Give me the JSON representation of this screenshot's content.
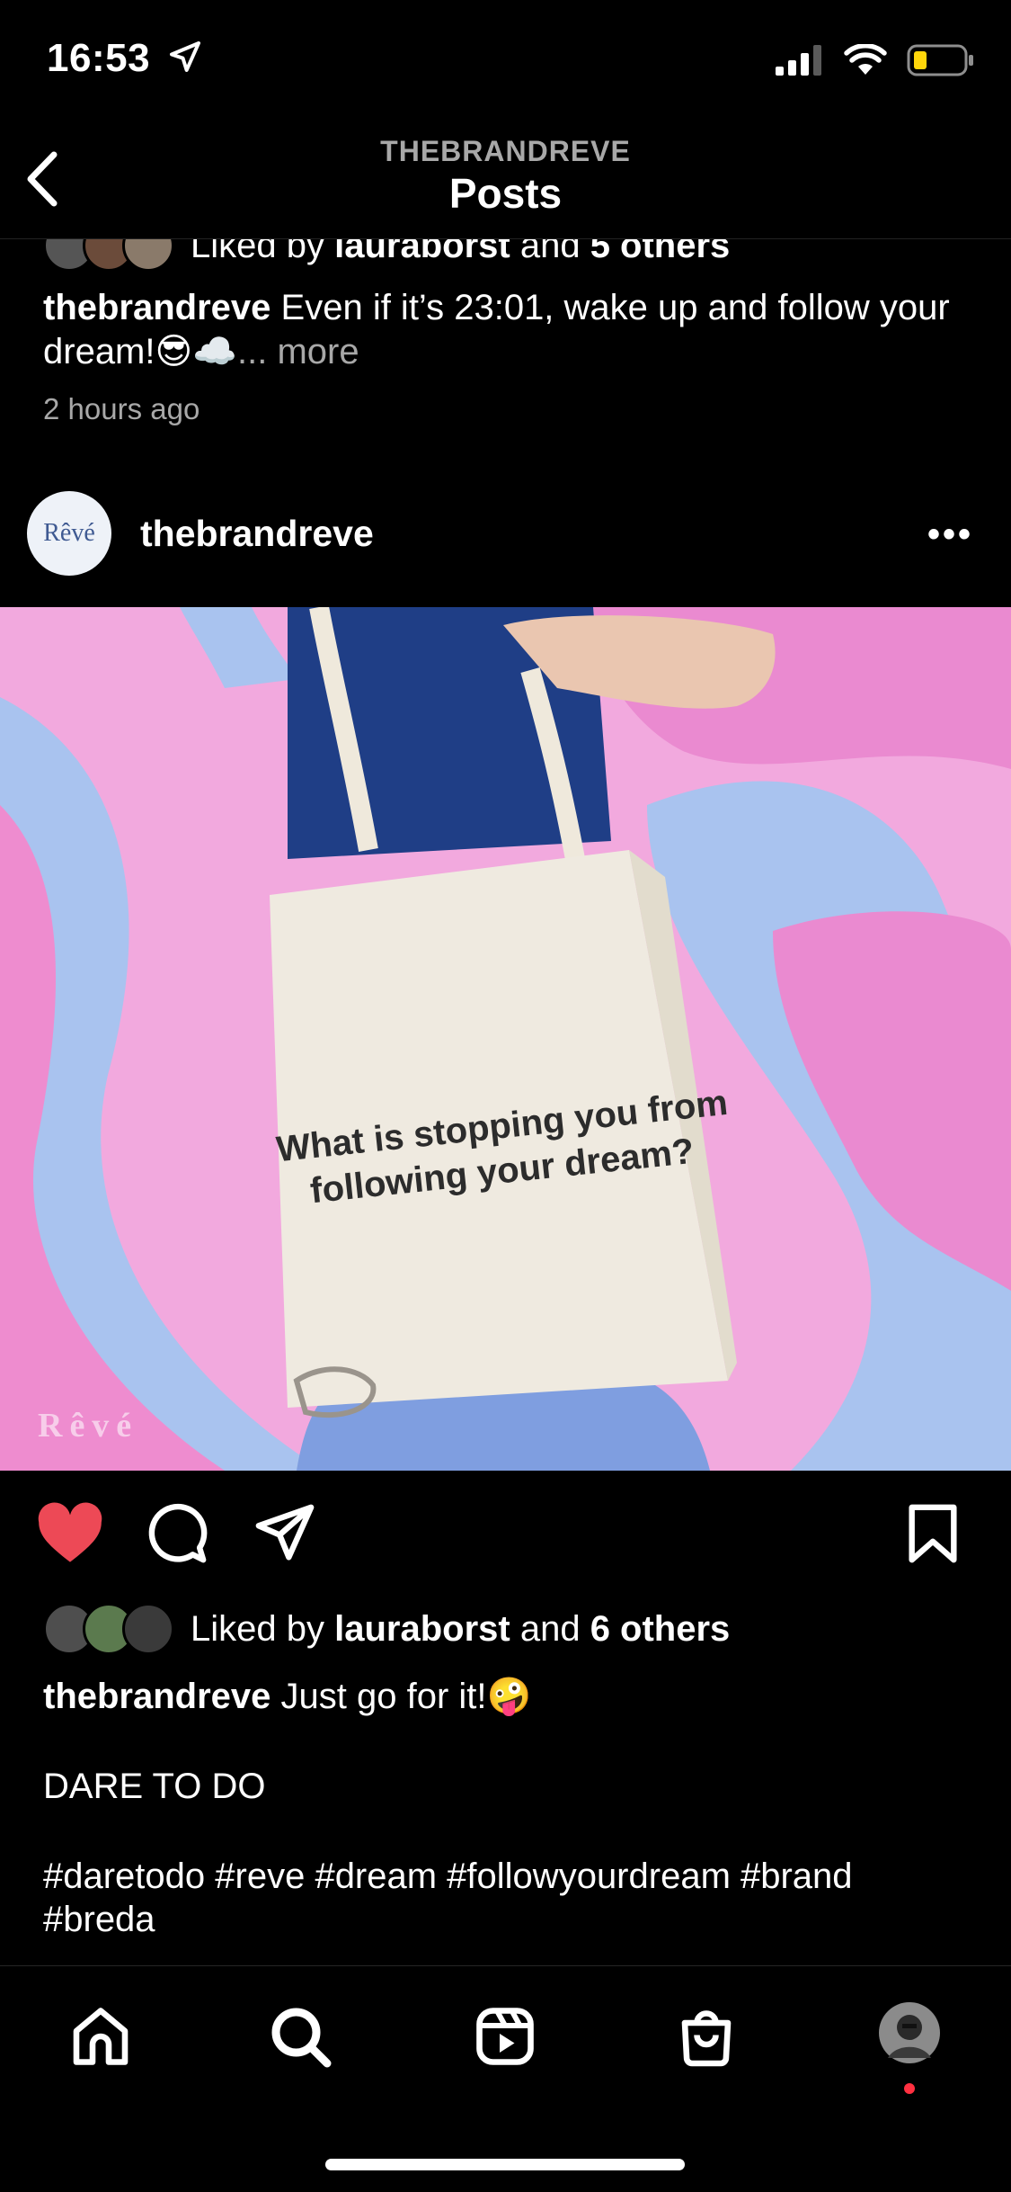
{
  "status_bar": {
    "time": "16:53"
  },
  "header": {
    "account": "THEBRANDREVE",
    "title": "Posts"
  },
  "previous_post": {
    "liked_prefix": "Liked by ",
    "liked_user": "lauraborst",
    "liked_mid": " and ",
    "liked_others": "5 others",
    "username": "thebrandreve",
    "caption": " Even if it’s 23:01, wake up and follow your dream!😎☁️",
    "more": "... more",
    "time": "2 hours ago"
  },
  "post": {
    "avatar_text": "Rêvé",
    "username": "thebrandreve",
    "image": {
      "bag_line1": "What is stopping you from",
      "bag_line2": "following your dream?",
      "watermark": "Rêvé"
    },
    "liked_prefix": "Liked by ",
    "liked_user": "lauraborst",
    "liked_mid": " and ",
    "liked_others": "6 others",
    "caption_user": "thebrandreve",
    "caption_text": " Just go for it!🤪",
    "caption_line2": "DARE TO DO",
    "hashtags": "#daretodo #reve #dream #followyourdream #brand #breda"
  },
  "colors": {
    "like": "#ed4956",
    "muted": "#a8a8a8"
  },
  "icons": [
    "location-arrow-icon",
    "signal-icon",
    "wifi-icon",
    "battery-icon",
    "back-chevron-icon",
    "more-icon",
    "heart-icon",
    "comment-icon",
    "share-icon",
    "bookmark-icon",
    "home-icon",
    "search-icon",
    "reels-icon",
    "shop-icon",
    "profile-avatar"
  ]
}
